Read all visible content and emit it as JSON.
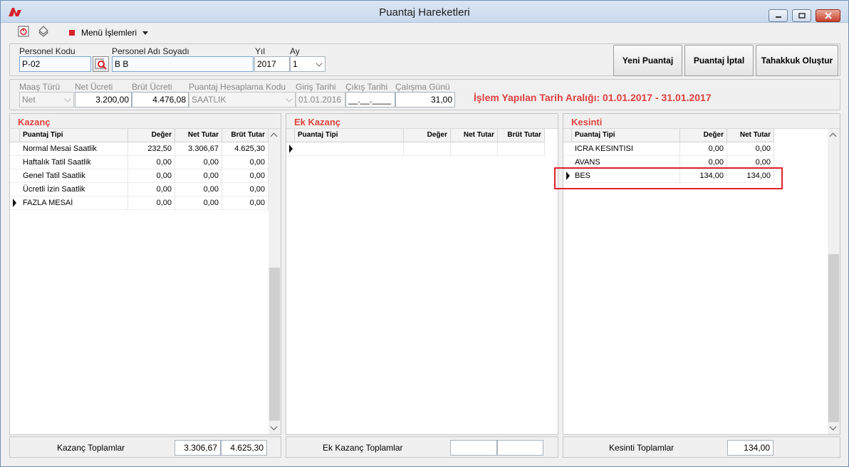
{
  "window": {
    "title": "Puantaj Hareketleri"
  },
  "toolbar": {
    "menu_label": "Menü İşlemleri"
  },
  "header": {
    "personel_kodu_label": "Personel Kodu",
    "personel_kodu": "P-02",
    "personel_adi_label": "Personel Adı Soyadı",
    "personel_adi": "B B",
    "yil_label": "Yıl",
    "yil": "2017",
    "ay_label": "Ay",
    "ay": "1"
  },
  "buttons": {
    "yeni_puantaj": "Yeni Puantaj",
    "puantaj_iptal": "Puantaj İptal",
    "tahakkuk_olustur": "Tahakkuk Oluştur"
  },
  "info": {
    "maas_turu_label": "Maaş Türü",
    "maas_turu": "Net",
    "net_ucret_label": "Net Ücreti",
    "net_ucret": "3.200,00",
    "brut_ucret_label": "Brüt Ücreti",
    "brut_ucret": "4.476,08",
    "hesaplama_kodu_label": "Puantaj Hesaplama Kodu",
    "hesaplama_kodu": "SAATLIK",
    "giris_tarihi_label": "Giriş Tarihi",
    "giris_tarihi": "01.01.2016",
    "cikis_tarihi_label": "Çıkış Tarihi",
    "cikis_tarihi": "__.__.____",
    "calisma_gunu_label": "Çalışma Günü",
    "calisma_gunu": "31,00",
    "range_text": "İşlem Yapılan Tarih Aralığı: 01.01.2017 - 31.01.2017"
  },
  "kazanc": {
    "title": "Kazanç",
    "columns": [
      "Puantaj Tipi",
      "Değer",
      "Net Tutar",
      "Brüt Tutar"
    ],
    "rows": [
      [
        "Normal Mesai Saatlik",
        "232,50",
        "3.306,67",
        "4.625,30"
      ],
      [
        "Haftalık Tatil Saatlik",
        "0,00",
        "0,00",
        "0,00"
      ],
      [
        "Genel Tatil Saatlik",
        "0,00",
        "0,00",
        "0,00"
      ],
      [
        "Ücretli İzin Saatlik",
        "0,00",
        "0,00",
        "0,00"
      ],
      [
        "FAZLA MESAİ",
        "0,00",
        "0,00",
        "0,00"
      ]
    ],
    "footer_label": "Kazanç Toplamlar",
    "total_net": "3.306,67",
    "total_brut": "4.625,30"
  },
  "ek_kazanc": {
    "title": "Ek Kazanç",
    "columns": [
      "Puantaj Tipi",
      "Değer",
      "Net Tutar",
      "Brüt Tutar"
    ],
    "footer_label": "Ek Kazanç Toplamlar",
    "total_net": "",
    "total_brut": ""
  },
  "kesinti": {
    "title": "Kesinti",
    "columns": [
      "Puantaj Tipi",
      "Değer",
      "Net Tutar"
    ],
    "rows": [
      [
        "ICRA KESINTISI",
        "0,00",
        "0,00"
      ],
      [
        "AVANS",
        "0,00",
        "0,00"
      ],
      [
        "BES",
        "134,00",
        "134,00"
      ]
    ],
    "footer_label": "Kesinti Toplamlar",
    "total_net": "134,00"
  },
  "colors": {
    "accent_red": "#e0413c",
    "highlight": "#e0212b"
  }
}
